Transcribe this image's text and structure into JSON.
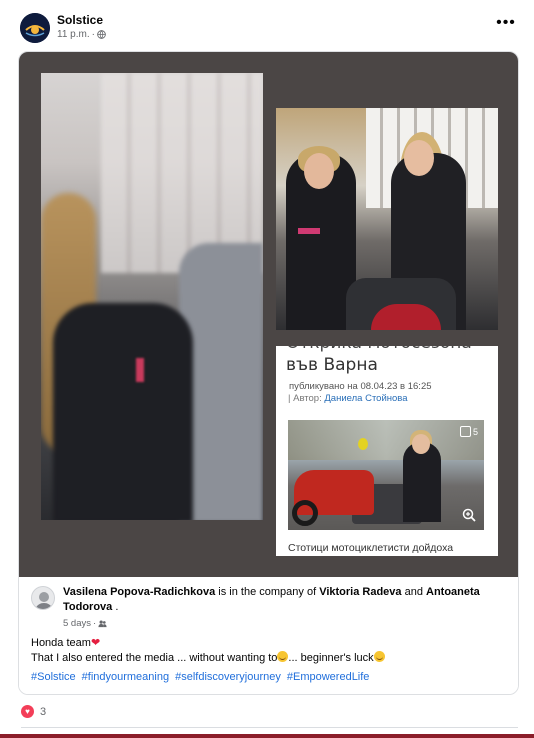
{
  "post": {
    "page_name": "Solstice",
    "timestamp": "11 p.m.",
    "privacy_icon": "globe-icon",
    "more_icon": "more-options-icon"
  },
  "shared_article": {
    "title": "Открика мотосезона във Варна",
    "title_visible": "във Варна",
    "published": "публикувано на 08.04.23 в 16:25",
    "author_prefix": "| Автор: ",
    "author": "Даниела Стойнова",
    "gallery_count": "5",
    "excerpt": "Стотици мотоциклетисти дойдоха"
  },
  "shared_post": {
    "author": "Vasilena Popova-Radichkova",
    "company_text": " is in the company of ",
    "tag1": "Viktoria Radeva",
    "and_text": " and ",
    "tag2": "Antoaneta Todorova",
    "end": " .",
    "time": "5 days",
    "line1": "Honda team",
    "line2_a": "That I also entered the media ... without wanting to",
    "line2_b": "... beginner's luck",
    "hashtags": [
      "#Solstice",
      "#findyourmeaning",
      "#selfdiscoveryjourney",
      "#EmpoweredLife"
    ]
  },
  "footer": {
    "reaction_count": "3",
    "reaction_icon": "love-reaction-icon"
  },
  "colors": {
    "media_bg": "#4b4645",
    "link": "#216fdb",
    "heart": "#e41e3f",
    "accent_bar": "#8b1e2a"
  }
}
